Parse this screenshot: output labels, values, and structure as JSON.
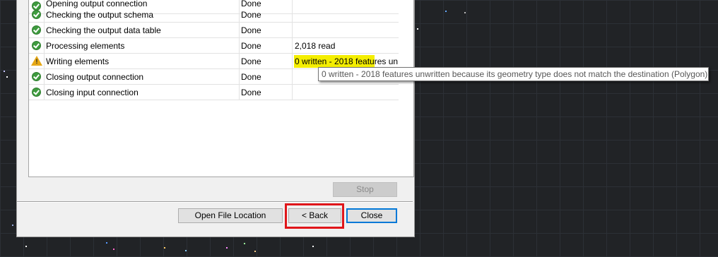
{
  "rows": [
    {
      "name": "Opening output connection",
      "status": "Done",
      "detail": "",
      "icon": "check-icon"
    },
    {
      "name": "Checking the output schema",
      "status": "Done",
      "detail": "",
      "icon": "check-icon"
    },
    {
      "name": "Checking the output data table",
      "status": "Done",
      "detail": "",
      "icon": "check-icon"
    },
    {
      "name": "Processing elements",
      "status": "Done",
      "detail": "2,018 read",
      "icon": "check-icon"
    },
    {
      "name": "Writing elements",
      "status": "Done",
      "detail": "0 written - 2018 features un...",
      "icon": "warning-icon"
    },
    {
      "name": "Closing output connection",
      "status": "Done",
      "detail": "",
      "icon": "check-icon"
    },
    {
      "name": "Closing input connection",
      "status": "Done",
      "detail": "",
      "icon": "check-icon"
    }
  ],
  "tooltip": "0 written - 2018 features unwritten because its geometry type does not match the destination (Polygon)",
  "buttons": {
    "stop": "Stop",
    "open_file_location": "Open File Location",
    "back": "< Back",
    "close": "Close"
  },
  "colors": {
    "highlight": "#f4ee00",
    "annotation_box": "#e0161a",
    "ok_icon": "#3f9b3f",
    "warning_icon": "#e6a817"
  }
}
